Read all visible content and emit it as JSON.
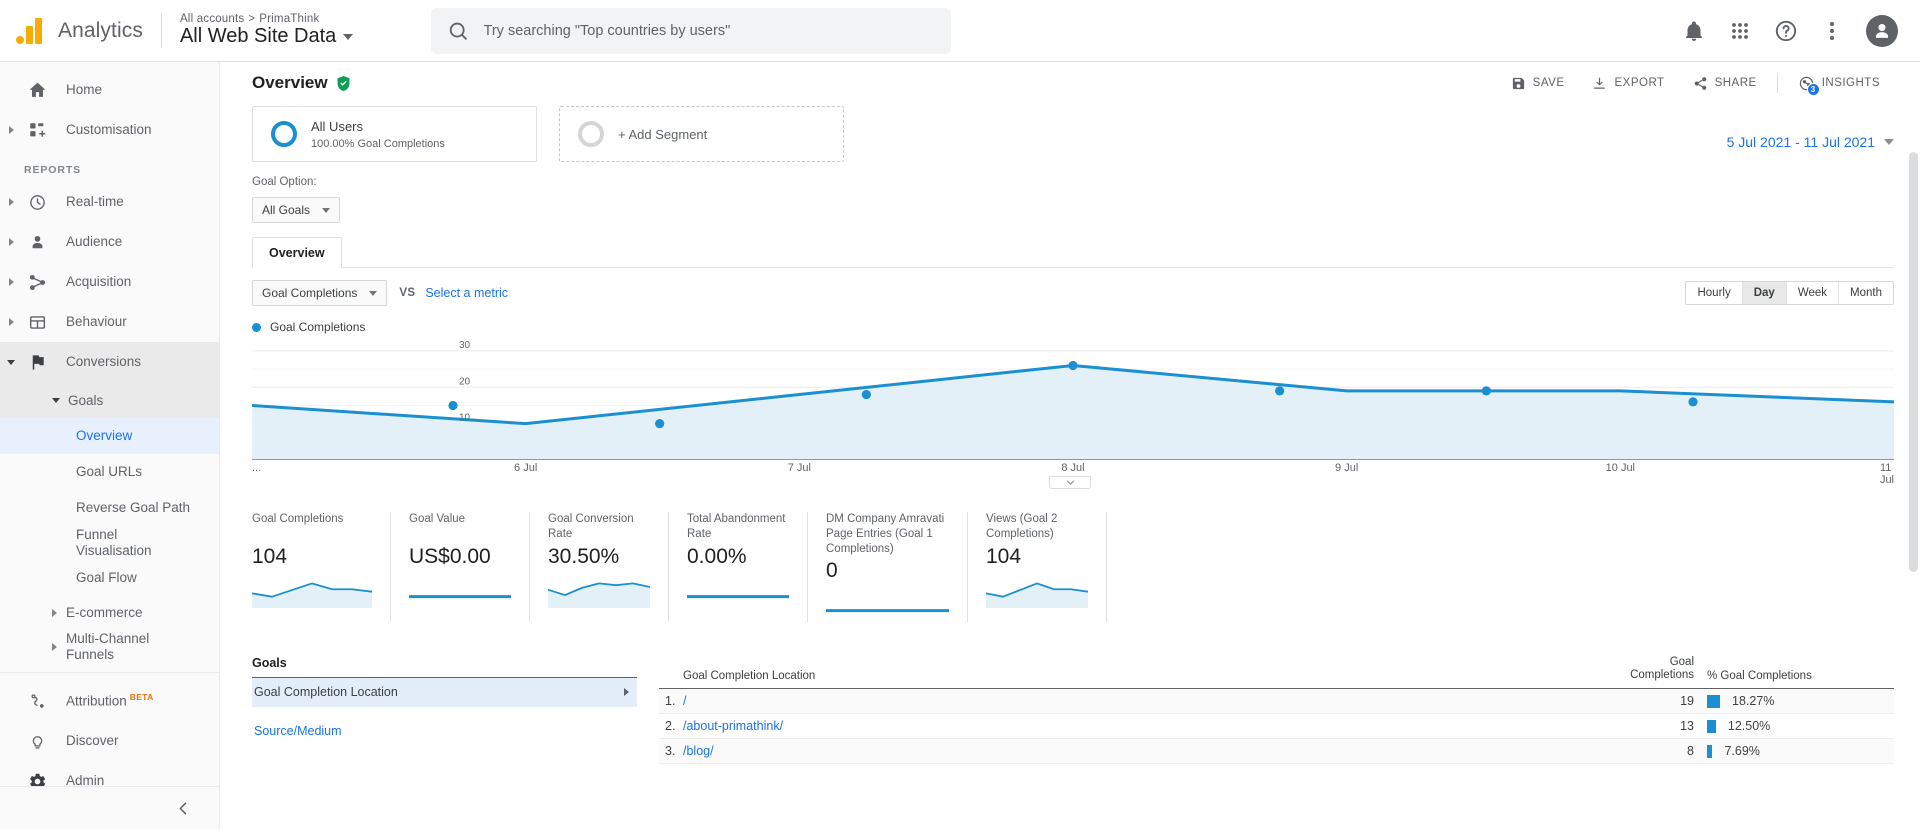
{
  "topbar": {
    "brand": "Analytics",
    "breadcrumb_accounts": "All accounts",
    "breadcrumb_sep": ">",
    "breadcrumb_property": "PrimaThink",
    "view_name": "All Web Site Data",
    "search_placeholder": "Try searching \"Top countries by users\"",
    "search_value": ""
  },
  "sidebar": {
    "home": "Home",
    "customisation": "Customisation",
    "reports_label": "REPORTS",
    "realtime": "Real-time",
    "audience": "Audience",
    "acquisition": "Acquisition",
    "behaviour": "Behaviour",
    "conversions": "Conversions",
    "goals": "Goals",
    "goal_children": [
      "Overview",
      "Goal URLs",
      "Reverse Goal Path",
      "Funnel Visualisation",
      "Goal Flow"
    ],
    "ecommerce": "E-commerce",
    "multichannel": "Multi-Channel Funnels",
    "attribution": "Attribution",
    "attribution_badge": "BETA",
    "discover": "Discover",
    "admin": "Admin"
  },
  "page": {
    "title": "Overview",
    "actions": {
      "save": "SAVE",
      "export": "EXPORT",
      "share": "SHARE",
      "insights": "INSIGHTS",
      "insights_count": "3"
    },
    "date_range": "5 Jul 2021 - 11 Jul 2021"
  },
  "segments": {
    "all_users_name": "All Users",
    "all_users_sub": "100.00% Goal Completions",
    "add_segment": "+ Add Segment"
  },
  "goal_option": {
    "label": "Goal Option:",
    "selected": "All Goals"
  },
  "tabs": [
    {
      "label": "Overview"
    }
  ],
  "metric_selector": {
    "primary": "Goal Completions",
    "vs": "VS",
    "secondary": "Select a metric",
    "granularity": [
      "Hourly",
      "Day",
      "Week",
      "Month"
    ],
    "granularity_selected": "Day"
  },
  "chart_data": {
    "type": "line",
    "title": "Goal Completions",
    "legend": [
      "Goal Completions"
    ],
    "legend_position": "top-left",
    "x": [
      "5 Jul",
      "6 Jul",
      "7 Jul",
      "8 Jul",
      "9 Jul",
      "10 Jul",
      "11 Jul"
    ],
    "xtick_labels": [
      "...",
      "6 Jul",
      "7 Jul",
      "8 Jul",
      "9 Jul",
      "10 Jul",
      "11 Jul"
    ],
    "values": [
      15,
      10,
      18,
      26,
      19,
      19,
      16
    ],
    "ylim": [
      0,
      33
    ],
    "yticks": [
      10,
      20,
      30
    ],
    "ytick_labels": [
      "10",
      "20",
      "30"
    ],
    "xlabel": "",
    "ylabel": "",
    "grid": true,
    "series_color": "#1a8fd1",
    "fill_color": "#e4f0f7"
  },
  "kpis": [
    {
      "label": "Goal Completions",
      "value": "104",
      "spark": [
        14,
        10,
        18,
        26,
        19,
        19,
        16
      ]
    },
    {
      "label": "Goal Value",
      "value": "US$0.00",
      "spark": [
        0,
        0,
        0,
        0,
        0,
        0,
        0
      ]
    },
    {
      "label": "Goal Conversion Rate",
      "value": "30.50%",
      "spark": [
        17,
        11,
        19,
        24,
        22,
        24,
        20
      ]
    },
    {
      "label": "Total Abandonment Rate",
      "value": "0.00%",
      "spark": [
        0,
        0,
        0,
        0,
        0,
        0,
        0
      ]
    },
    {
      "label": "DM Company Amravati Page Entries (Goal 1 Completions)",
      "value": "0",
      "spark": [
        0,
        0,
        0,
        0,
        0,
        0,
        0
      ]
    },
    {
      "label": "Views (Goal 2 Completions)",
      "value": "104",
      "spark": [
        14,
        10,
        18,
        26,
        19,
        19,
        16
      ]
    }
  ],
  "goals_panel": {
    "title": "Goals",
    "items": [
      {
        "label": "Goal Completion Location",
        "selected": true
      },
      {
        "label": "Source/Medium",
        "selected": false
      }
    ]
  },
  "location_table": {
    "columns": [
      "Goal Completion Location",
      "Goal\nCompletions",
      "% Goal Completions"
    ],
    "col1": "Goal Completion Location",
    "col2_line1": "Goal",
    "col2_line2": "Completions",
    "col3": "% Goal Completions",
    "rows": [
      {
        "idx": "1.",
        "name": "/",
        "completions": "19",
        "pct": "18.27%",
        "pct_num": 18.27
      },
      {
        "idx": "2.",
        "name": "/about-primathink/",
        "completions": "13",
        "pct": "12.50%",
        "pct_num": 12.5
      },
      {
        "idx": "3.",
        "name": "/blog/",
        "completions": "8",
        "pct": "7.69%",
        "pct_num": 7.69
      }
    ]
  }
}
